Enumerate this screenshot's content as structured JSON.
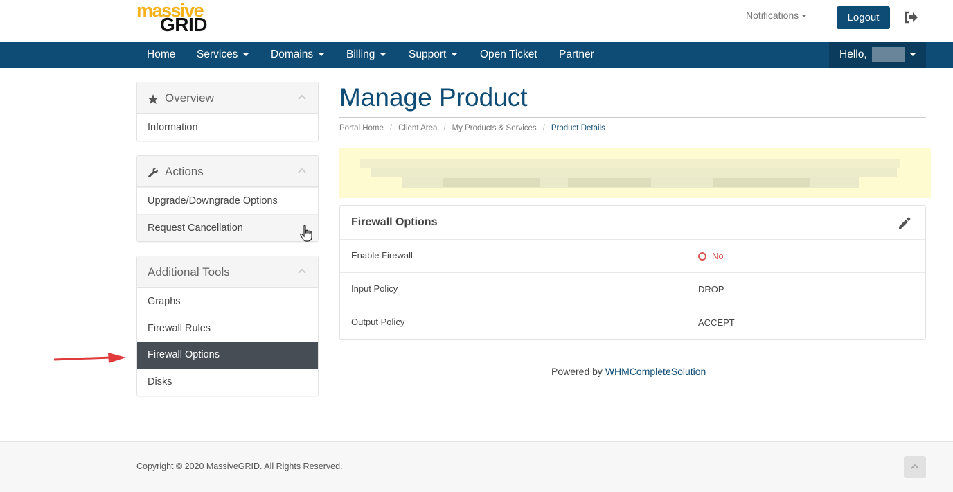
{
  "brand": {
    "line1": "massive",
    "line2": "GRID"
  },
  "header": {
    "notifications": "Notifications",
    "logout": "Logout"
  },
  "nav": {
    "items": [
      "Home",
      "Services",
      "Domains",
      "Billing",
      "Support",
      "Open Ticket",
      "Partner"
    ],
    "hello": "Hello,"
  },
  "sidebar": {
    "overview": {
      "title": "Overview",
      "items": [
        "Information"
      ]
    },
    "actions": {
      "title": "Actions",
      "items": [
        "Upgrade/Downgrade Options",
        "Request Cancellation"
      ]
    },
    "tools": {
      "title": "Additional Tools",
      "items": [
        "Graphs",
        "Firewall Rules",
        "Firewall Options",
        "Disks"
      ],
      "active": "Firewall Options"
    }
  },
  "main": {
    "title": "Manage Product",
    "breadcrumb": [
      "Portal Home",
      "Client Area",
      "My Products & Services",
      "Product Details"
    ],
    "card": {
      "title": "Firewall Options",
      "rows": [
        {
          "label": "Enable Firewall",
          "value": "No"
        },
        {
          "label": "Input Policy",
          "value": "DROP"
        },
        {
          "label": "Output Policy",
          "value": "ACCEPT"
        }
      ]
    },
    "powered": {
      "prefix": "Powered by",
      "link": "WHMCompleteSolution"
    }
  },
  "footer": {
    "copyright": "Copyright © 2020 MassiveGRID. All Rights Reserved."
  },
  "colors": {
    "primary": "#0f4c75",
    "active_item": "#474d54",
    "logo_orange": "#f5b21a",
    "no_red": "#d9534f"
  }
}
